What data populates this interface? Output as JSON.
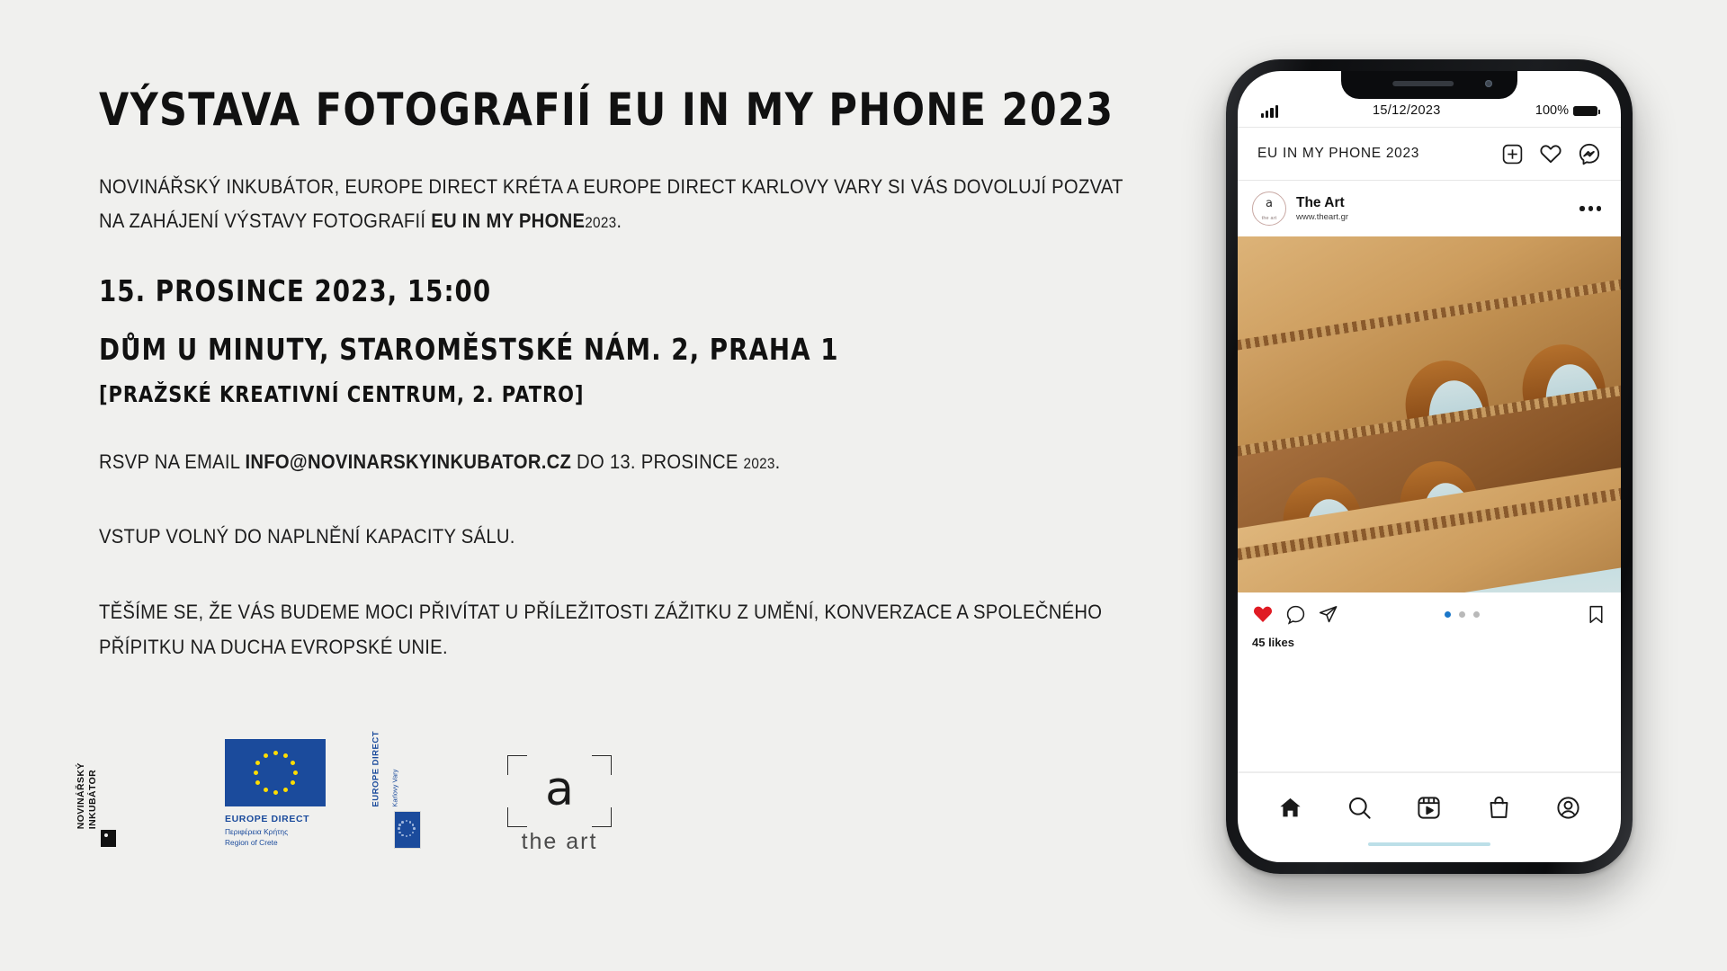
{
  "poster": {
    "title": "VÝSTAVA FOTOGRAFIÍ EU IN MY PHONE 2023",
    "intro_part1": "NOVINÁŘSKÝ INKUBÁTOR, EUROPE DIRECT KRÉTA A EUROPE DIRECT KARLOVY VARY SI VÁS DOVOLUJÍ POZVAT NA ZAHÁJENÍ VÝSTAVY FOTOGRAFIÍ ",
    "intro_bold": "EU IN MY PHONE",
    "intro_year": "2023",
    "intro_end": ".",
    "date_line": "15. PROSINCE 2023, 15:00",
    "venue_line": "DŮM U MINUTY, STAROMĚSTSKÉ NÁM. 2, PRAHA 1",
    "venue_sub": "[PRAŽSKÉ KREATIVNÍ CENTRUM, 2. PATRO]",
    "rsvp_prefix": "RSVP NA EMAIL ",
    "rsvp_email": "INFO@NOVINARSKYINKUBATOR.CZ",
    "rsvp_mid": " DO 13. PROSINCE ",
    "rsvp_year": "2023",
    "rsvp_end": ".",
    "entry_line": "VSTUP VOLNÝ DO NAPLNĚNÍ KAPACITY SÁLU.",
    "closing_line": "TĚŠÍME SE, ŽE VÁS BUDEME MOCI PŘIVÍTAT U PŘÍLEŽITOSTI ZÁŽITKU Z UMĚNÍ, KONVERZACE A SPOLEČNÉHO PŘÍPITKU NA DUCHA EVROPSKÉ UNIE."
  },
  "logos": [
    {
      "id": "novinarsky-inkubator",
      "line1": "NOVINÁŘSKÝ",
      "line2": "INKUBÁTOR"
    },
    {
      "id": "europe-direct-crete",
      "name": "EUROPE DIRECT",
      "sub1": "Περιφέρεια Κρήτης",
      "sub2": "Region of Crete"
    },
    {
      "id": "europe-direct-karlovy-vary",
      "name": "EUROPE DIRECT",
      "sub1": "Karlovy Vary"
    },
    {
      "id": "the-art",
      "glyph": "a",
      "word": "the art"
    }
  ],
  "phone": {
    "statusbar": {
      "signal_icon": "signal-bars-icon",
      "date": "15/12/2023",
      "battery_percent": "100%",
      "battery_icon": "battery-full-icon"
    },
    "app_header": {
      "title": "EU IN MY PHONE 2023",
      "icons": [
        "add-post-icon",
        "heart-icon",
        "messenger-icon"
      ]
    },
    "post": {
      "account_name": "The Art",
      "account_url": "www.theart.gr",
      "avatar_glyph": "a",
      "avatar_word": "the art",
      "more_icon": "more-options-icon",
      "photo_alt": "colosseum-photo",
      "actions": [
        "like-icon",
        "comment-icon",
        "share-icon",
        "bookmark-icon"
      ],
      "carousel_dots": 3,
      "carousel_active_index": 0,
      "likes": "45 likes",
      "like_color": "#e01b24",
      "dot_active_color": "#1b77c9"
    },
    "tabbar": {
      "items": [
        "home-icon",
        "search-icon",
        "reels-icon",
        "shop-icon",
        "profile-icon"
      ]
    }
  },
  "colors": {
    "background": "#f0f0ee",
    "ink": "#111111",
    "eu_blue": "#1b4b9c",
    "eu_yellow": "#ffdd00",
    "home_indicator": "#bcdfe8"
  }
}
